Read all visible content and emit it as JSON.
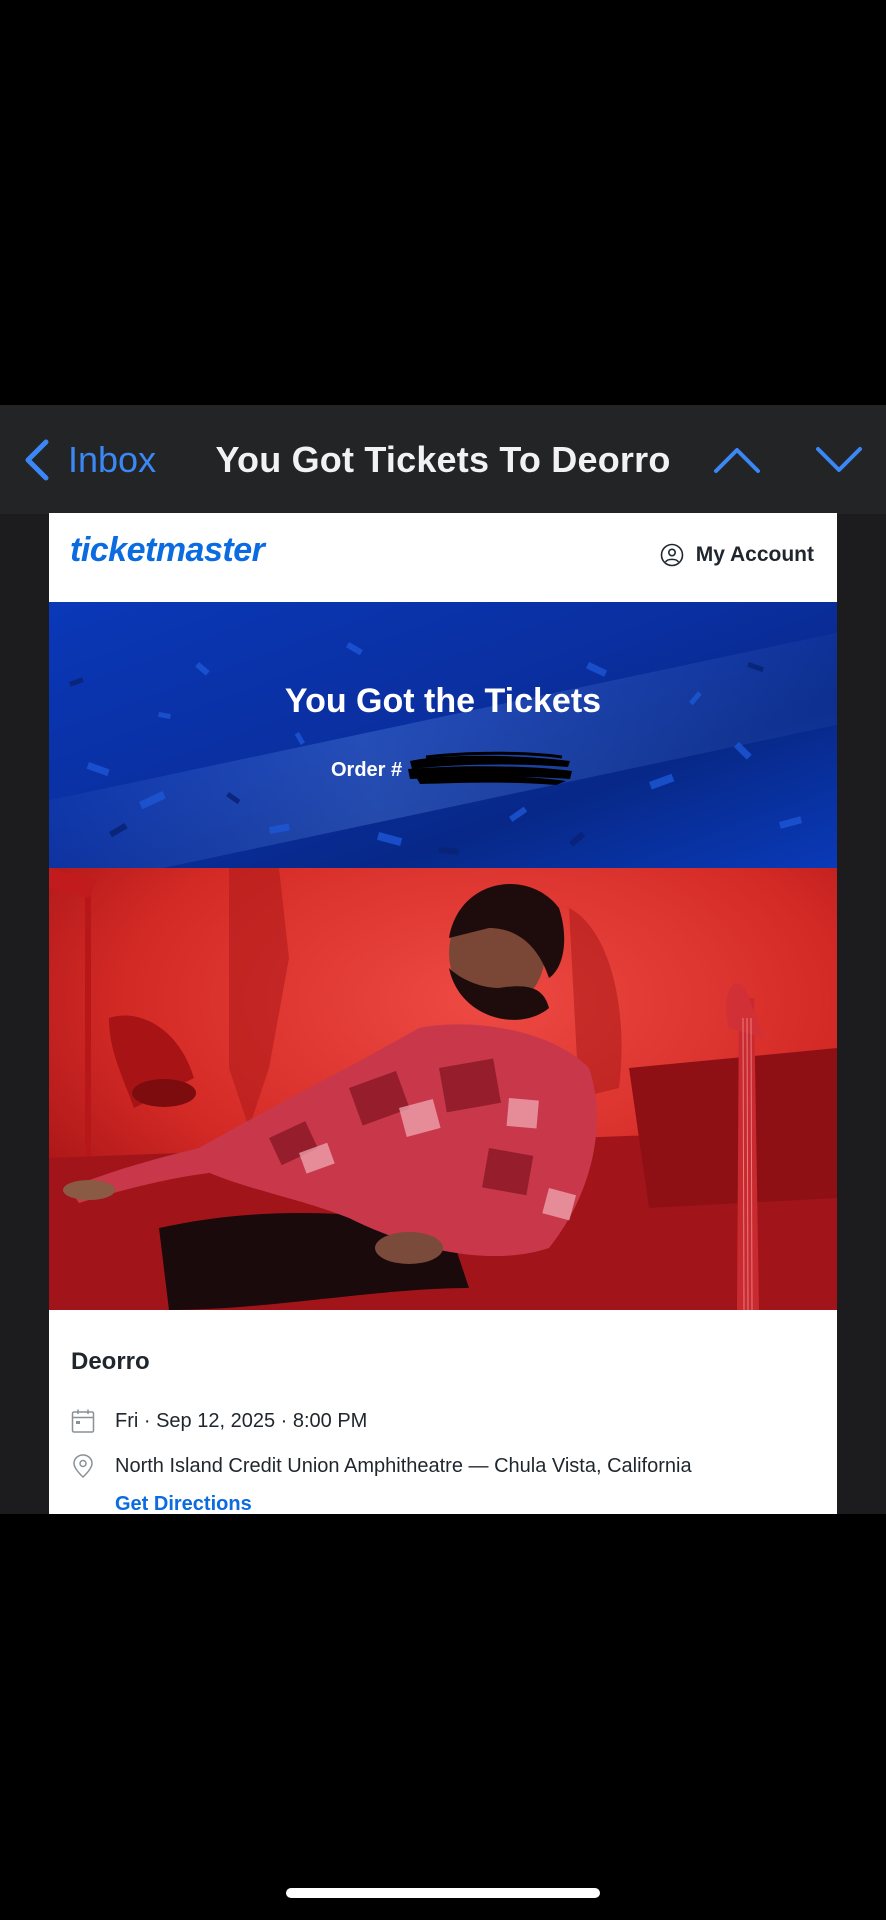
{
  "nav": {
    "back_label": "Inbox",
    "title": "You Got Tickets To Deorro"
  },
  "email": {
    "brand": "ticketmaster",
    "account_label": "My Account",
    "hero_title": "You Got the Tickets",
    "order_label": "Order #",
    "event_name": "Deorro",
    "date_time": "Fri · Sep 12, 2025 · 8:00 PM",
    "venue": "North Island Credit Union Amphitheatre — Chula Vista, California",
    "directions_label": "Get Directions"
  },
  "colors": {
    "accent": "#3b87f5",
    "brand_blue": "#0b6be0",
    "hero_blue": "#0a2fa0",
    "photo_red": "#c8141a"
  },
  "icons": [
    "chevron-left-icon",
    "chevron-up-icon",
    "chevron-down-icon",
    "user-circle-icon",
    "calendar-icon",
    "location-pin-icon"
  ]
}
